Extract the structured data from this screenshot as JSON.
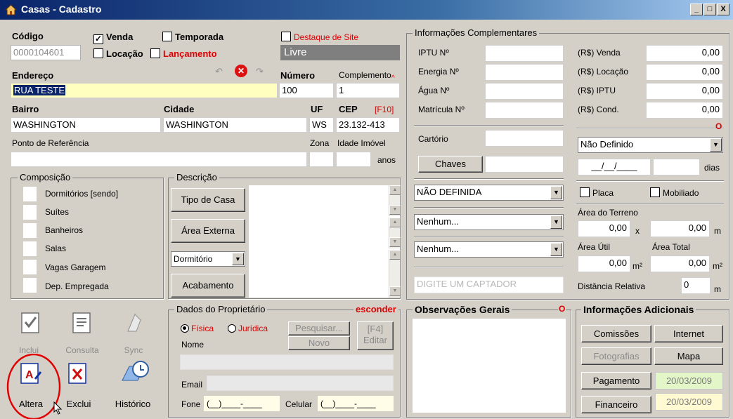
{
  "window": {
    "title": "Casas - Cadastro",
    "min": "_",
    "max": "□",
    "close": "X"
  },
  "labels": {
    "codigo": "Código",
    "venda": "Venda",
    "temporada": "Temporada",
    "destaque": "Destaque de Site",
    "locacao": "Locação",
    "lancamento": "Lançamento",
    "endereco": "Endereço",
    "numero": "Número",
    "complemento": "Complemento",
    "bairro": "Bairro",
    "cidade": "Cidade",
    "uf": "UF",
    "cep": "CEP",
    "f10": "[F10]",
    "referencia": "Ponto de Referência",
    "zona": "Zona",
    "idade": "Idade Imóvel",
    "anos": "anos"
  },
  "values": {
    "codigo": "0000104601",
    "status": "Livre",
    "endereco": "RUA TESTE",
    "numero": "100",
    "complemento": "1",
    "bairro": "WASHINGTON",
    "cidade": "WASHINGTON",
    "uf": "WS",
    "cep": "23.132-413",
    "referencia": "",
    "zona": "",
    "idade": ""
  },
  "composicao": {
    "title": "Composição",
    "items": [
      "Dormitórios [sendo]",
      "Suítes",
      "Banheiros",
      "Salas",
      "Vagas Garagem",
      "Dep. Empregada"
    ]
  },
  "descricao": {
    "title": "Descrição",
    "tipo": "Tipo de Casa",
    "area": "Área Externa",
    "dorm_select": "Dormitório",
    "acabamento": "Acabamento"
  },
  "info": {
    "title": "Informações Complementares",
    "iptu": "IPTU Nº",
    "energia": "Energia Nº",
    "agua": "Água Nº",
    "matricula": "Matrícula Nº",
    "cartorio": "Cartório",
    "chaves": "Chaves",
    "definida": "NÃO DEFINIDA",
    "nenhum1": "Nenhum...",
    "nenhum2": "Nenhum...",
    "captador": "DIGITE UM CAPTADOR"
  },
  "valores": {
    "venda_lbl": "(R$) Venda",
    "venda": "0,00",
    "locacao_lbl": "(R$) Locação",
    "locacao": "0,00",
    "iptu_lbl": "(R$) IPTU",
    "iptu": "0,00",
    "cond_lbl": "(R$) Cond.",
    "cond": "0,00",
    "o": "O",
    "nao_definido": "Não Definido",
    "data": "__/__/____",
    "dias": "dias",
    "placa": "Placa",
    "mobiliado": "Mobiliado",
    "area_terreno": "Área do Terreno",
    "terreno1": "0,00",
    "x": "x",
    "terreno2": "0,00",
    "m": "m",
    "area_util": "Área Útil",
    "area_total": "Área Total",
    "util": "0,00",
    "total": "0,00",
    "m2": "m²",
    "distancia": "Distância Relativa",
    "dist_val": "0",
    "dist_m": "m"
  },
  "toolbar": {
    "inclui": "Inclui",
    "consulta": "Consulta",
    "sync": "Sync",
    "altera": "Altera",
    "exclui": "Exclui",
    "historico": "Histórico"
  },
  "proprietario": {
    "title": "Dados do Proprietário",
    "esconder": "esconder",
    "fisica": "Física",
    "juridica": "Jurídica",
    "pesquisar": "Pesquisar...",
    "novo": "Novo",
    "f4": "[F4]",
    "editar": "Editar",
    "nome": "Nome",
    "email": "Email",
    "fone": "Fone",
    "fone_mask": "(__)____-____",
    "celular": "Celular",
    "cel_mask": "(__)____-____"
  },
  "obs": {
    "title": "Observações Gerais",
    "o": "O"
  },
  "adicionais": {
    "title": "Informações Adicionais",
    "comissoes": "Comissões",
    "internet": "Internet",
    "fotografias": "Fotografias",
    "mapa": "Mapa",
    "pagamento": "Pagamento",
    "financeiro": "Financeiro",
    "date1": "20/03/2009",
    "date2": "20/03/2009"
  },
  "colors": {
    "title_start": "#0a246a",
    "status_bg": "#7f7f7f",
    "highlight": "#0a246a",
    "address_bg": "#ffffc0",
    "date1_bg": "#e2f6c8",
    "date2_bg": "#fffad2",
    "red": "#e00000"
  }
}
